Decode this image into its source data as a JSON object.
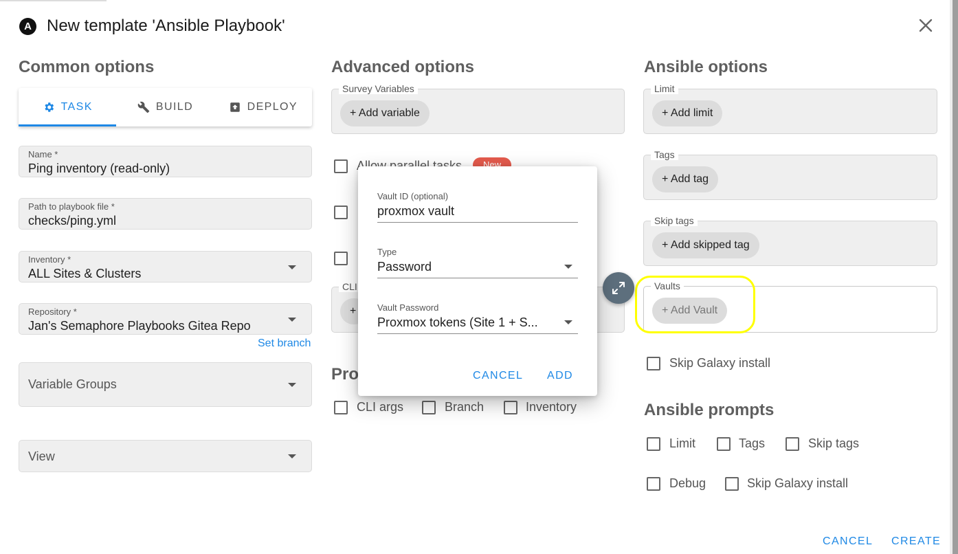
{
  "dialog_title": "New template 'Ansible Playbook'",
  "logo_letter": "A",
  "common": {
    "title": "Common options",
    "tabs": [
      {
        "label": "TASK",
        "icon": "gear-icon",
        "active": true
      },
      {
        "label": "BUILD",
        "icon": "wrench-icon",
        "active": false
      },
      {
        "label": "DEPLOY",
        "icon": "upload-box-icon",
        "active": false
      }
    ],
    "name": {
      "label": "Name *",
      "value": "Ping inventory (read-only)"
    },
    "playbook": {
      "label": "Path to playbook file *",
      "value": "checks/ping.yml"
    },
    "inventory": {
      "label": "Inventory *",
      "value": "ALL Sites & Clusters"
    },
    "repository": {
      "label": "Repository *",
      "value": "Jan's Semaphore Playbooks Gitea Repo"
    },
    "set_branch": "Set branch",
    "variable_groups": "Variable Groups",
    "view": "View"
  },
  "advanced": {
    "title": "Advanced options",
    "survey_label": "Survey Variables",
    "add_variable": "+ Add variable",
    "allow_parallel": "Allow parallel tasks",
    "new_badge": "New",
    "cli_label": "CLI",
    "prompts_title": "Pro",
    "prompts": [
      "CLI args",
      "Branch",
      "Inventory"
    ]
  },
  "ansible": {
    "title": "Ansible options",
    "limit_label": "Limit",
    "add_limit": "+ Add limit",
    "tags_label": "Tags",
    "add_tag": "+ Add tag",
    "skip_tags_label": "Skip tags",
    "add_skipped_tag": "+ Add skipped tag",
    "vaults_label": "Vaults",
    "add_vault": "+ Add Vault",
    "skip_galaxy": "Skip Galaxy install",
    "prompts_title": "Ansible prompts",
    "prompts_row1": [
      "Limit",
      "Tags",
      "Skip tags"
    ],
    "prompts_row2": [
      "Debug",
      "Skip Galaxy install"
    ]
  },
  "vault_dialog": {
    "vault_id_label": "Vault ID (optional)",
    "vault_id_value": "proxmox vault",
    "type_label": "Type",
    "type_value": "Password",
    "password_label": "Vault Password",
    "password_value": "Proxmox tokens (Site 1 + S...",
    "cancel": "CANCEL",
    "add": "ADD"
  },
  "footer": {
    "cancel": "CANCEL",
    "create": "CREATE"
  },
  "colors": {
    "accent": "#1e88e5",
    "highlight": "#ffff00",
    "badge": "#e55b4d",
    "fab": "#5d6f7d"
  }
}
